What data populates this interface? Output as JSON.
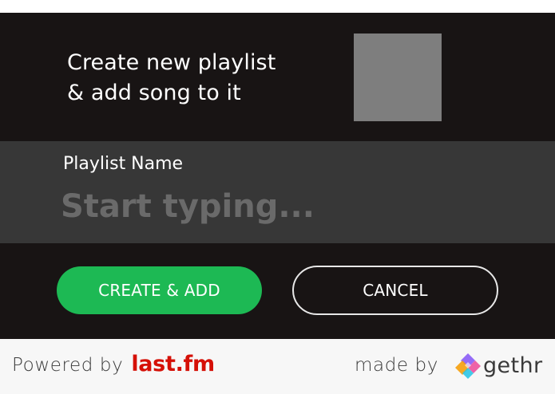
{
  "dialog": {
    "title_line1": "Create new playlist",
    "title_line2": "& add song to it",
    "name_field": {
      "label": "Playlist Name",
      "placeholder": "Start typing...",
      "value": ""
    },
    "buttons": {
      "create_label": "CREATE & ADD",
      "cancel_label": "CANCEL"
    }
  },
  "footer": {
    "powered_text": "Powered by",
    "lastfm_logo": "last.fm",
    "madeby_text": "made by",
    "gethr_logo": "gethr"
  },
  "colors": {
    "dialog_bg": "#181414",
    "input_section_bg": "#373737",
    "accent_green": "#1db954",
    "lastfm_red": "#d51007",
    "placeholder_gray": "#7e7e7e"
  },
  "icons": {
    "playlist_art": "image-placeholder",
    "gethr_logo": "gethr-diamond-icon"
  }
}
